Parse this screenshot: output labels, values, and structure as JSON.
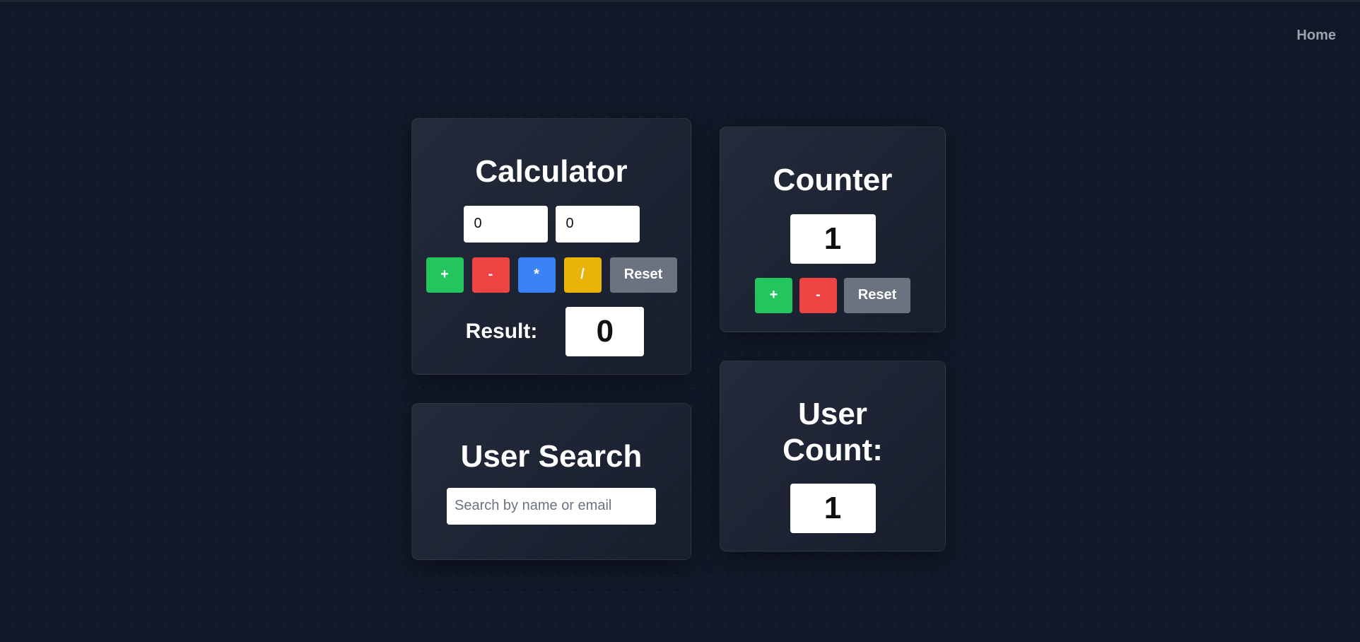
{
  "nav": {
    "home_label": "Home"
  },
  "calculator": {
    "title": "Calculator",
    "input1_value": "0",
    "input2_value": "0",
    "ops": {
      "add": "+",
      "subtract": "-",
      "multiply": "*",
      "divide": "/",
      "reset": "Reset"
    },
    "result_label": "Result:",
    "result_value": "0"
  },
  "counter": {
    "title": "Counter",
    "value": "1",
    "ops": {
      "increment": "+",
      "decrement": "-",
      "reset": "Reset"
    }
  },
  "user_search": {
    "title": "User Search",
    "placeholder": "Search by name or email",
    "value": ""
  },
  "user_count": {
    "title": "User Count:",
    "value": "1"
  },
  "colors": {
    "background": "#111827",
    "green": "#22c55e",
    "red": "#ef4444",
    "blue": "#3b82f6",
    "yellow": "#eab308",
    "gray": "#6b7280"
  }
}
